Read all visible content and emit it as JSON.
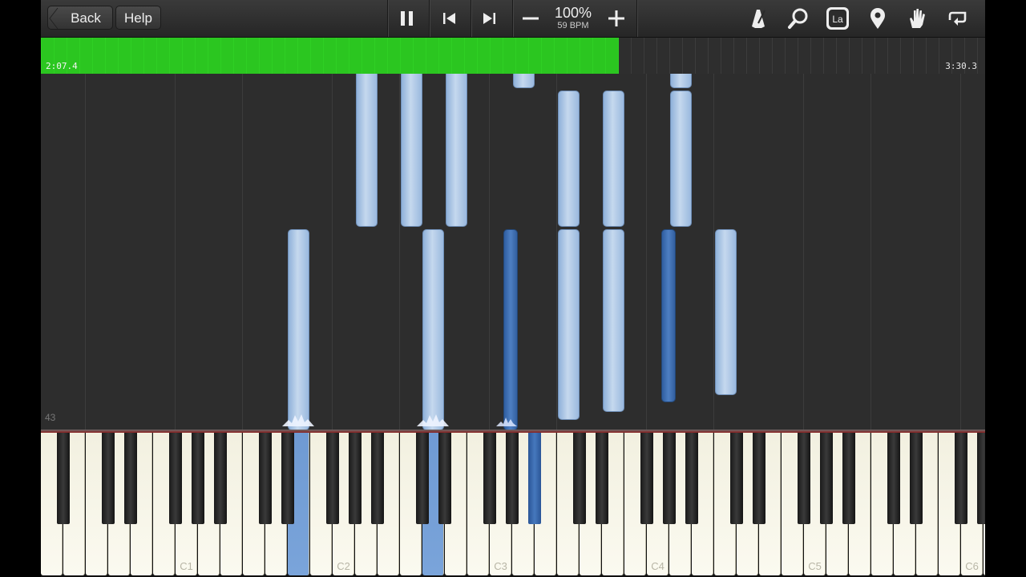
{
  "toolbar": {
    "back_label": "Back",
    "help_label": "Help",
    "speed_percent": "100%",
    "speed_bpm": "59 BPM",
    "icons": [
      "pause-icon",
      "skip-back-icon",
      "skip-forward-icon",
      "minus-icon",
      "plus-icon",
      "metronome-icon",
      "magnifier-icon",
      "label-la-icon",
      "location-pin-icon",
      "hand-icon",
      "loop-icon"
    ],
    "label_icon_text": "La"
  },
  "progress": {
    "current_time": "2:07.4",
    "total_time": "3:30.3",
    "fraction": 0.612
  },
  "note_area": {
    "measure_number": "43"
  },
  "keyboard": {
    "octave_labels": [
      "C1",
      "C2",
      "C3",
      "C4",
      "C5",
      "C6"
    ]
  },
  "colors": {
    "progress_green": "#2bc620",
    "note_light": "#b7cde9",
    "note_dark": "#3e6fb2",
    "background": "#2d2d2d"
  }
}
